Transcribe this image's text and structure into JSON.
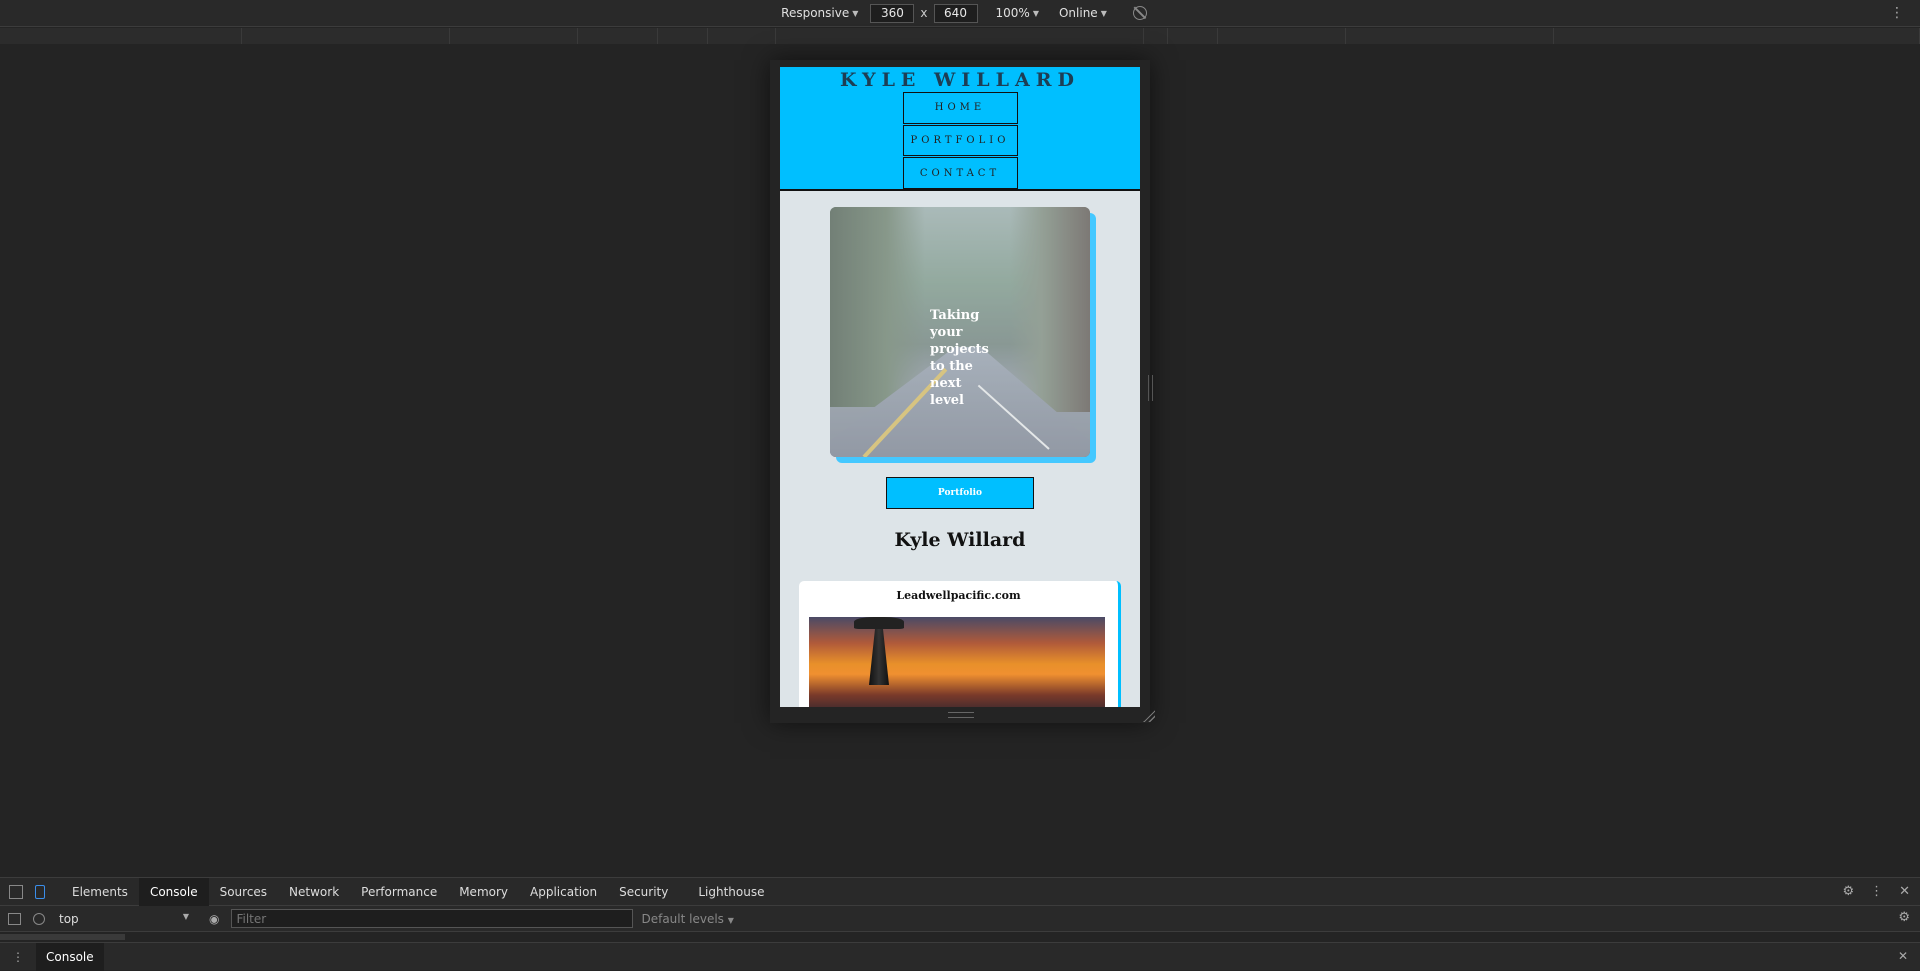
{
  "toolbar": {
    "device_mode": "Responsive",
    "width": "360",
    "height": "640",
    "times": "x",
    "zoom": "100%",
    "throttle": "Online"
  },
  "site": {
    "title": "KYLE WILLARD",
    "nav": [
      "HOME",
      "PORTFOLIO",
      "CONTACT"
    ],
    "hero_text": "Taking your projects to the next level",
    "cta_label": "Portfolio",
    "name_heading": "Kyle Willard",
    "card_title": "Leadwellpacific.com",
    "accent_color": "#00bfff"
  },
  "devtools": {
    "tabs": [
      "Elements",
      "Console",
      "Sources",
      "Network",
      "Performance",
      "Memory",
      "Application",
      "Security",
      "Lighthouse"
    ],
    "active_tab": "Console",
    "context": "top",
    "filter_placeholder": "Filter",
    "levels": "Default levels",
    "drawer_tab": "Console"
  }
}
